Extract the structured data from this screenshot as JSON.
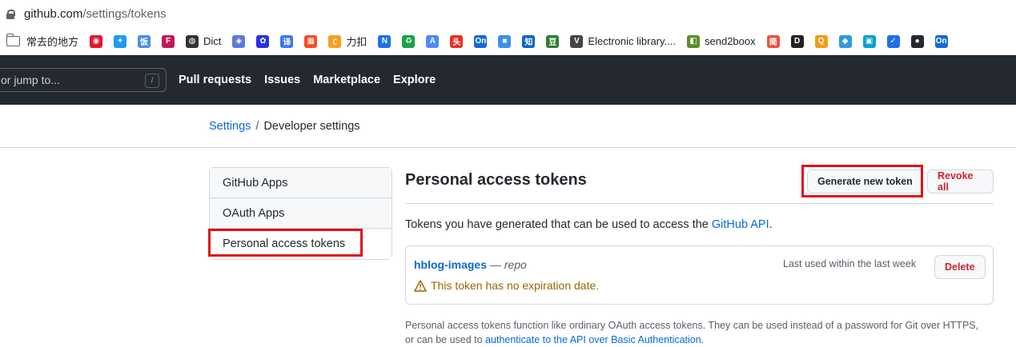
{
  "browser": {
    "url_host": "github.com",
    "url_path": "/settings/tokens"
  },
  "bookmarks": [
    {
      "label": "常去的地方",
      "icon": "folder-icon"
    },
    {
      "label": "",
      "icon": "weibo-icon",
      "color": "#e6162d",
      "glyph": "◉"
    },
    {
      "label": "",
      "icon": "twitter-icon",
      "color": "#1d9bf0",
      "glyph": "✦"
    },
    {
      "label": "",
      "icon": "fanyi-icon",
      "color": "#4a90d9",
      "glyph": "饭"
    },
    {
      "label": "",
      "icon": "fw-icon",
      "color": "#c2185b",
      "glyph": "F"
    },
    {
      "label": "Dict",
      "icon": "globe-icon",
      "color": "#333333",
      "glyph": "◍"
    },
    {
      "label": "",
      "icon": "ai-icon",
      "color": "#5b7bd5",
      "glyph": "◈"
    },
    {
      "label": "",
      "icon": "baidu-icon",
      "color": "#2932e1",
      "glyph": "✿"
    },
    {
      "label": "",
      "icon": "translate-icon",
      "color": "#3478f6",
      "glyph": "译"
    },
    {
      "label": "",
      "icon": "microsoft-icon",
      "color": "#f25022",
      "glyph": "▦"
    },
    {
      "label": "力扣",
      "icon": "leetcode-icon",
      "color": "#f89f1b",
      "glyph": "ʗ"
    },
    {
      "label": "",
      "icon": "n-icon",
      "color": "#1f6feb",
      "glyph": "N"
    },
    {
      "label": "",
      "icon": "recycle-icon",
      "color": "#17a34a",
      "glyph": "♻"
    },
    {
      "label": "",
      "icon": "a-icon",
      "color": "#4c8bf5",
      "glyph": "A"
    },
    {
      "label": "",
      "icon": "toutiao-icon",
      "color": "#e8312a",
      "glyph": "头"
    },
    {
      "label": "",
      "icon": "on-icon",
      "color": "#1769d6",
      "glyph": "On"
    },
    {
      "label": "",
      "icon": "chat-icon",
      "color": "#3d8ef0",
      "glyph": "■"
    },
    {
      "label": "",
      "icon": "zhihu-icon",
      "color": "#0a66c2",
      "glyph": "知"
    },
    {
      "label": "",
      "icon": "douban-icon",
      "color": "#2f7d32",
      "glyph": "豆"
    },
    {
      "label": "Electronic library....",
      "icon": "v-icon",
      "color": "#444444",
      "glyph": "V"
    },
    {
      "label": "send2boox",
      "icon": "boox-icon",
      "color": "#5a8f29",
      "glyph": "◧"
    },
    {
      "label": "",
      "icon": "jian-icon",
      "color": "#e5533d",
      "glyph": "简"
    },
    {
      "label": "",
      "icon": "d-icon",
      "color": "#222222",
      "glyph": "D"
    },
    {
      "label": "",
      "icon": "q-icon",
      "color": "#f39c12",
      "glyph": "Q"
    },
    {
      "label": "",
      "icon": "diamond-icon",
      "color": "#2d9cdb",
      "glyph": "◆"
    },
    {
      "label": "",
      "icon": "bilibili-icon",
      "color": "#00a1d6",
      "glyph": "▣"
    },
    {
      "label": "",
      "icon": "blue-check-icon",
      "color": "#1f6feb",
      "glyph": "✓"
    },
    {
      "label": "",
      "icon": "github-icon",
      "color": "#24292f",
      "glyph": "●"
    },
    {
      "label": "",
      "icon": "on2-icon",
      "color": "#1769d6",
      "glyph": "On"
    }
  ],
  "header": {
    "search_placeholder": "or jump to...",
    "search_shortcut": "/",
    "nav": [
      "Pull requests",
      "Issues",
      "Marketplace",
      "Explore"
    ]
  },
  "breadcrumb": {
    "root": "Settings",
    "separator": "/",
    "current": "Developer settings"
  },
  "sidebar": {
    "items": [
      {
        "label": "GitHub Apps"
      },
      {
        "label": "OAuth Apps"
      },
      {
        "label": "Personal access tokens"
      }
    ]
  },
  "main": {
    "title": "Personal access tokens",
    "generate_button": "Generate new token",
    "revoke_button": "Revoke all",
    "intro_text": "Tokens you have generated that can be used to access the ",
    "intro_link": "GitHub API",
    "intro_end": ".",
    "token": {
      "name": "hblog-images",
      "dash": " — ",
      "scope": "repo",
      "last_used": "Last used within the last week",
      "delete_button": "Delete",
      "warning": "This token has no expiration date."
    },
    "footnote_line1": "Personal access tokens function like ordinary OAuth access tokens. They can be used instead of a password for Git over HTTPS,",
    "footnote_line2_start": "or can be used to ",
    "footnote_link": "authenticate to the API over Basic Authentication",
    "footnote_line2_end": "."
  },
  "colors": {
    "highlight": "#e0101b",
    "link": "#0969da",
    "danger": "#cf222e",
    "warning": "#9a6700",
    "header_bg": "#24292f"
  }
}
